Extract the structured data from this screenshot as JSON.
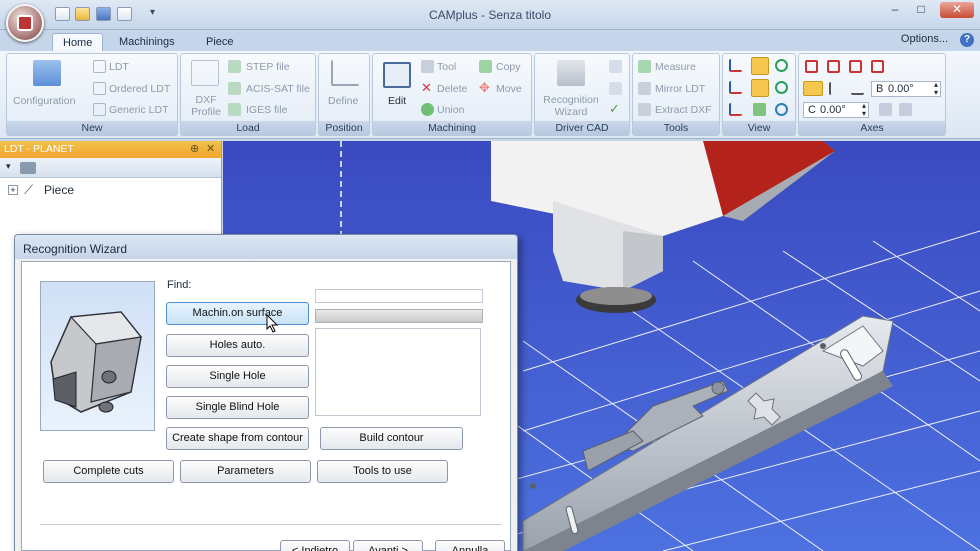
{
  "app": {
    "title": "CAMplus - Senza titolo"
  },
  "tabs": [
    {
      "label": "Home"
    },
    {
      "label": "Machinings"
    },
    {
      "label": "Piece"
    }
  ],
  "options_label": "Options...",
  "ribbon": {
    "new": {
      "label": "New",
      "configuration": "Configuration",
      "ldt": "LDT",
      "ordered_ldt": "Ordered LDT",
      "generic_ldt": "Generic LDT"
    },
    "load": {
      "label": "Load",
      "dxf_profile": "DXF Profile",
      "step": "STEP file",
      "acis": "ACIS-SAT file",
      "iges": "IGES file"
    },
    "position": {
      "label": "Position",
      "define": "Define"
    },
    "machining": {
      "label": "Machining",
      "edit": "Edit",
      "tool": "Tool",
      "copy": "Copy",
      "delete": "Delete",
      "move": "Move",
      "union": "Union"
    },
    "driver_cad": {
      "label": "Driver CAD",
      "recognition": "Recognition Wizard"
    },
    "tools": {
      "label": "Tools",
      "measure": "Measure",
      "mirror": "Mirror LDT",
      "extract": "Extract DXF"
    },
    "view": {
      "label": "View"
    },
    "axes": {
      "label": "Axes",
      "b_label": "B",
      "b_value": "0.00°",
      "c_label": "C",
      "c_value": "0.00°"
    }
  },
  "ldt_panel": {
    "title": "LDT - PLANET",
    "tree_item": "Piece"
  },
  "dialog": {
    "title": "Recognition Wizard",
    "find_label": "Find:",
    "buttons": {
      "machin_surface": "Machin.on surface",
      "holes_auto": "Holes auto.",
      "single_hole": "Single Hole",
      "single_blind_hole": "Single Blind Hole",
      "create_shape": "Create shape from contour",
      "build_contour": "Build contour",
      "complete_cuts": "Complete cuts",
      "parameters": "Parameters",
      "tools_to_use": "Tools to use"
    },
    "nav": {
      "back": "< Indietro",
      "next": "Avanti >",
      "cancel": "Annulla"
    }
  },
  "colors": {
    "viewport_blue": "#4058cf",
    "head_red": "#b3231c",
    "panel_orange": "#f2ad33"
  }
}
